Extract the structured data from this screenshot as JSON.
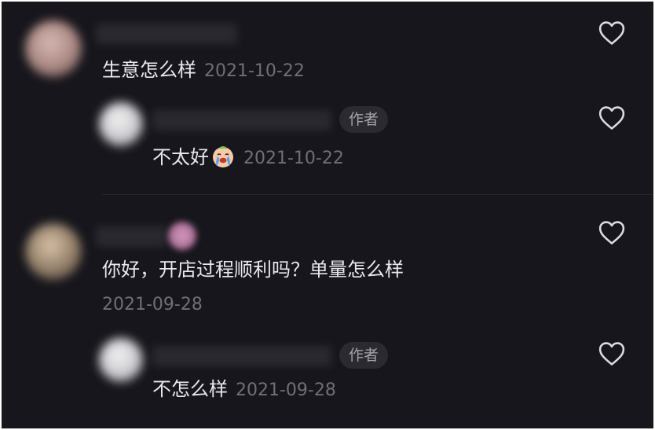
{
  "comments": [
    {
      "text": "生意怎么样",
      "date": "2021-10-22",
      "reply": {
        "badge": "作者",
        "text": "不太好",
        "emoji": "crying-face-emoji",
        "date": "2021-10-22"
      }
    },
    {
      "text": "你好，开店过程顺利吗？单量怎么样",
      "date": "2021-09-28",
      "reply": {
        "badge": "作者",
        "text": "不怎么样",
        "date": "2021-09-28"
      }
    }
  ],
  "icons": {
    "like": "heart-outline-icon"
  },
  "colors": {
    "background": "#17161c",
    "text": "#e9e9ec",
    "muted": "#6f6f77",
    "badge_bg": "#2a2a30"
  }
}
